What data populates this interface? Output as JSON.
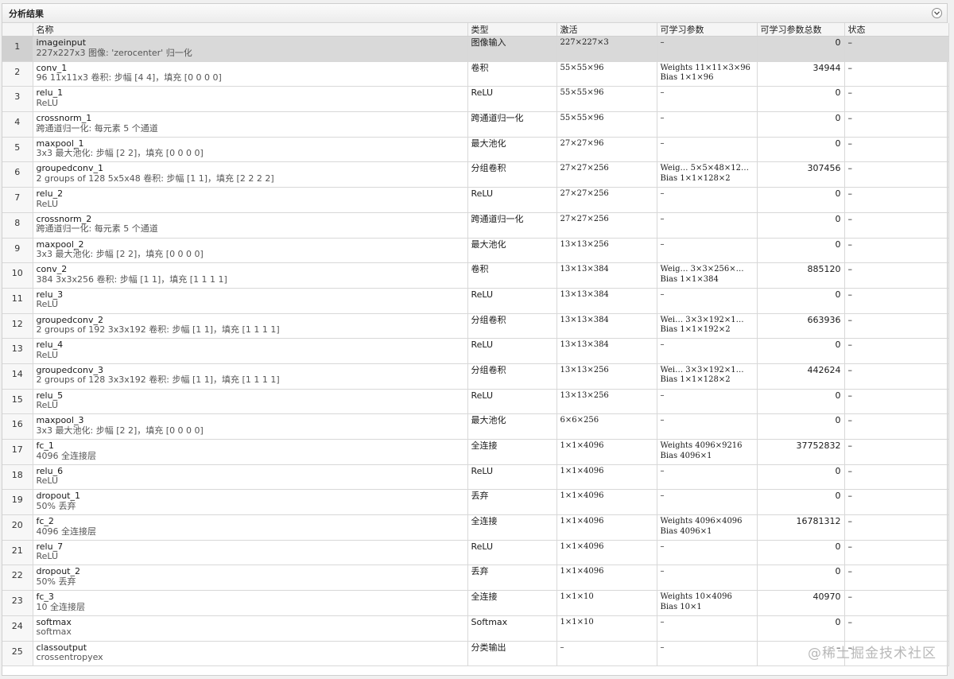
{
  "panel": {
    "title": "分析结果",
    "collapse_icon": "chevron-down-icon"
  },
  "columns": [
    "",
    "名称",
    "类型",
    "激活",
    "可学习参数",
    "可学习参数总数",
    "状态"
  ],
  "rows": [
    {
      "idx": "1",
      "name": "imageinput",
      "desc": "227x227x3 图像: 'zerocenter' 归一化",
      "type": "图像输入",
      "act": "227×227×3",
      "p1": "–",
      "p2": "",
      "total": "0",
      "status": "–"
    },
    {
      "idx": "2",
      "name": "conv_1",
      "desc": "96 11x11x3 卷积: 步幅 [4 4]，填充 [0 0 0 0]",
      "type": "卷积",
      "act": "55×55×96",
      "p1": "Weights  11×11×3×96",
      "p2": "Bias     1×1×96",
      "total": "34944",
      "status": "–"
    },
    {
      "idx": "3",
      "name": "relu_1",
      "desc": "ReLU",
      "type": "ReLU",
      "act": "55×55×96",
      "p1": "–",
      "p2": "",
      "total": "0",
      "status": "–"
    },
    {
      "idx": "4",
      "name": "crossnorm_1",
      "desc": "跨通道归一化: 每元素 5 个通道",
      "type": "跨通道归一化",
      "act": "55×55×96",
      "p1": "–",
      "p2": "",
      "total": "0",
      "status": "–"
    },
    {
      "idx": "5",
      "name": "maxpool_1",
      "desc": "3x3 最大池化: 步幅 [2 2]，填充 [0 0 0 0]",
      "type": "最大池化",
      "act": "27×27×96",
      "p1": "–",
      "p2": "",
      "total": "0",
      "status": "–"
    },
    {
      "idx": "6",
      "name": "groupedconv_1",
      "desc": "2 groups of 128 5x5x48 卷积: 步幅 [1 1]，填充 [2 2 2 2]",
      "type": "分组卷积",
      "act": "27×27×256",
      "p1": "Weig…   5×5×48×12…",
      "p2": "Bias     1×1×128×2",
      "total": "307456",
      "status": "–"
    },
    {
      "idx": "7",
      "name": "relu_2",
      "desc": "ReLU",
      "type": "ReLU",
      "act": "27×27×256",
      "p1": "–",
      "p2": "",
      "total": "0",
      "status": "–"
    },
    {
      "idx": "8",
      "name": "crossnorm_2",
      "desc": "跨通道归一化: 每元素 5 个通道",
      "type": "跨通道归一化",
      "act": "27×27×256",
      "p1": "–",
      "p2": "",
      "total": "0",
      "status": "–"
    },
    {
      "idx": "9",
      "name": "maxpool_2",
      "desc": "3x3 最大池化: 步幅 [2 2]，填充 [0 0 0 0]",
      "type": "最大池化",
      "act": "13×13×256",
      "p1": "–",
      "p2": "",
      "total": "0",
      "status": "–"
    },
    {
      "idx": "10",
      "name": "conv_2",
      "desc": "384 3x3x256 卷积: 步幅 [1 1]，填充 [1 1 1 1]",
      "type": "卷积",
      "act": "13×13×384",
      "p1": "Weig…    3×3×256×…",
      "p2": "Bias     1×1×384",
      "total": "885120",
      "status": "–"
    },
    {
      "idx": "11",
      "name": "relu_3",
      "desc": "ReLU",
      "type": "ReLU",
      "act": "13×13×384",
      "p1": "–",
      "p2": "",
      "total": "0",
      "status": "–"
    },
    {
      "idx": "12",
      "name": "groupedconv_2",
      "desc": "2 groups of 192 3x3x192 卷积: 步幅 [1 1]，填充 [1 1 1 1]",
      "type": "分组卷积",
      "act": "13×13×384",
      "p1": "Wei…    3×3×192×1…",
      "p2": "Bias     1×1×192×2",
      "total": "663936",
      "status": "–"
    },
    {
      "idx": "13",
      "name": "relu_4",
      "desc": "ReLU",
      "type": "ReLU",
      "act": "13×13×384",
      "p1": "–",
      "p2": "",
      "total": "0",
      "status": "–"
    },
    {
      "idx": "14",
      "name": "groupedconv_3",
      "desc": "2 groups of 128 3x3x192 卷积: 步幅 [1 1]，填充 [1 1 1 1]",
      "type": "分组卷积",
      "act": "13×13×256",
      "p1": "Wei…    3×3×192×1…",
      "p2": "Bias     1×1×128×2",
      "total": "442624",
      "status": "–"
    },
    {
      "idx": "15",
      "name": "relu_5",
      "desc": "ReLU",
      "type": "ReLU",
      "act": "13×13×256",
      "p1": "–",
      "p2": "",
      "total": "0",
      "status": "–"
    },
    {
      "idx": "16",
      "name": "maxpool_3",
      "desc": "3x3 最大池化: 步幅 [2 2]，填充 [0 0 0 0]",
      "type": "最大池化",
      "act": "6×6×256",
      "p1": "–",
      "p2": "",
      "total": "0",
      "status": "–"
    },
    {
      "idx": "17",
      "name": "fc_1",
      "desc": "4096 全连接层",
      "type": "全连接",
      "act": "1×1×4096",
      "p1": "Weights  4096×9216",
      "p2": "Bias     4096×1",
      "total": "37752832",
      "status": "–"
    },
    {
      "idx": "18",
      "name": "relu_6",
      "desc": "ReLU",
      "type": "ReLU",
      "act": "1×1×4096",
      "p1": "–",
      "p2": "",
      "total": "0",
      "status": "–"
    },
    {
      "idx": "19",
      "name": "dropout_1",
      "desc": "50% 丢弃",
      "type": "丢弃",
      "act": "1×1×4096",
      "p1": "–",
      "p2": "",
      "total": "0",
      "status": "–"
    },
    {
      "idx": "20",
      "name": "fc_2",
      "desc": "4096 全连接层",
      "type": "全连接",
      "act": "1×1×4096",
      "p1": "Weights  4096×4096",
      "p2": "Bias     4096×1",
      "total": "16781312",
      "status": "–"
    },
    {
      "idx": "21",
      "name": "relu_7",
      "desc": "ReLU",
      "type": "ReLU",
      "act": "1×1×4096",
      "p1": "–",
      "p2": "",
      "total": "0",
      "status": "–"
    },
    {
      "idx": "22",
      "name": "dropout_2",
      "desc": "50% 丢弃",
      "type": "丢弃",
      "act": "1×1×4096",
      "p1": "–",
      "p2": "",
      "total": "0",
      "status": "–"
    },
    {
      "idx": "23",
      "name": "fc_3",
      "desc": "10 全连接层",
      "type": "全连接",
      "act": "1×1×10",
      "p1": "Weights  10×4096",
      "p2": "Bias     10×1",
      "total": "40970",
      "status": "–"
    },
    {
      "idx": "24",
      "name": "softmax",
      "desc": "softmax",
      "type": "Softmax",
      "act": "1×1×10",
      "p1": "–",
      "p2": "",
      "total": "0",
      "status": "–"
    },
    {
      "idx": "25",
      "name": "classoutput",
      "desc": "crossentropyex",
      "type": "分类输出",
      "act": "–",
      "p1": "–",
      "p2": "",
      "total": "–",
      "status": "–"
    }
  ],
  "selected_row": "1",
  "watermark": "@稀土掘金技术社区"
}
